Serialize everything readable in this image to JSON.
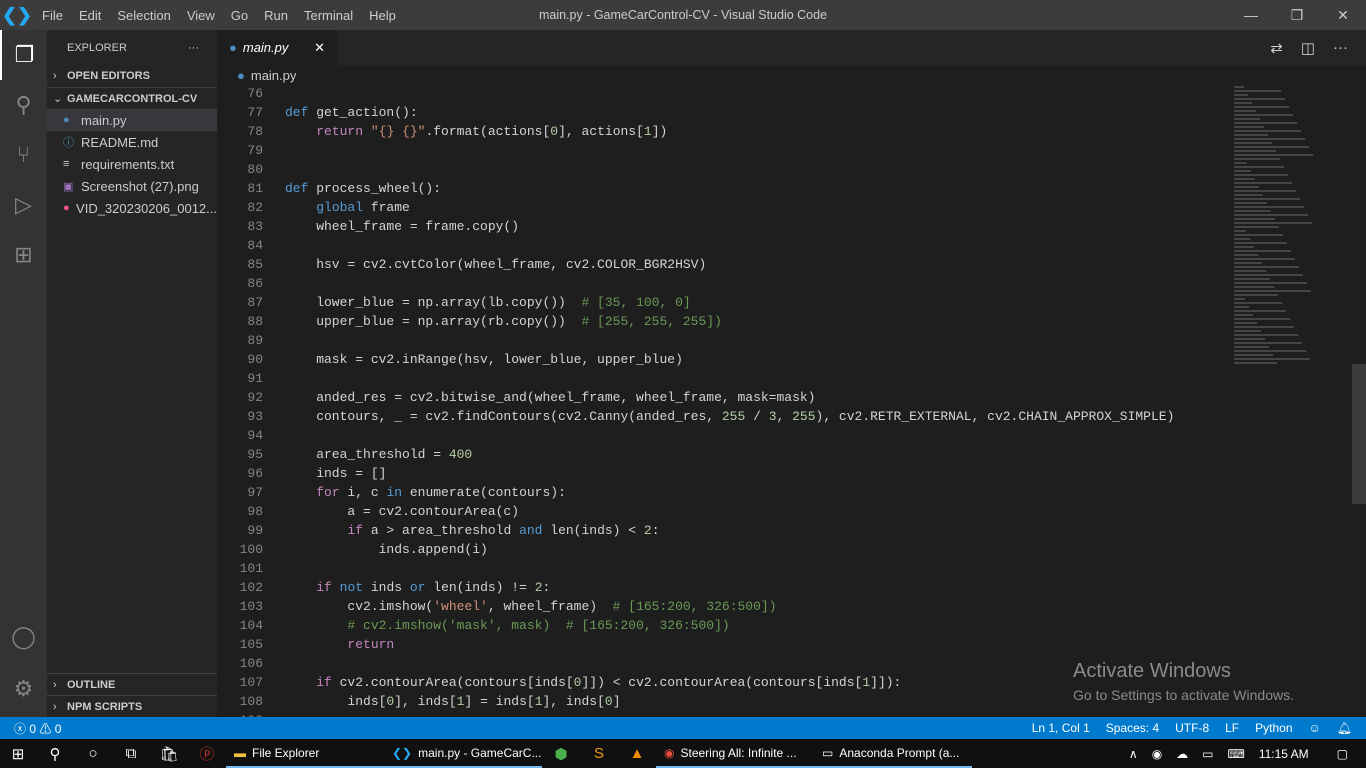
{
  "window": {
    "title": "main.py - GameCarControl-CV - Visual Studio Code",
    "menu": [
      "File",
      "Edit",
      "Selection",
      "View",
      "Go",
      "Run",
      "Terminal",
      "Help"
    ]
  },
  "sidebar": {
    "title": "EXPLORER",
    "open_editors": "OPEN EDITORS",
    "folder": "GAMECARCONTROL-CV",
    "files": [
      {
        "name": "main.py",
        "icon": "python-icon",
        "sel": true
      },
      {
        "name": "README.md",
        "icon": "info-icon"
      },
      {
        "name": "requirements.txt",
        "icon": "lines-icon"
      },
      {
        "name": "Screenshot (27).png",
        "icon": "image-icon"
      },
      {
        "name": "VID_320230206_0012...",
        "icon": "video-icon"
      }
    ],
    "outline": "OUTLINE",
    "npm": "NPM SCRIPTS"
  },
  "editor": {
    "tab": "main.py",
    "breadcrumb": "main.py",
    "lines": [
      [
        76,
        []
      ],
      [
        77,
        [
          [
            "k",
            "def"
          ],
          [
            "p",
            " get_action():"
          ]
        ]
      ],
      [
        78,
        [
          [
            "p",
            "    "
          ],
          [
            "c",
            "return"
          ],
          [
            "p",
            " "
          ],
          [
            "s",
            "\"{} {}\""
          ],
          [
            "p",
            ".format(actions["
          ],
          [
            "n",
            "0"
          ],
          [
            "p",
            "], actions["
          ],
          [
            "n",
            "1"
          ],
          [
            "p",
            "])"
          ]
        ]
      ],
      [
        79,
        []
      ],
      [
        80,
        []
      ],
      [
        81,
        [
          [
            "k",
            "def"
          ],
          [
            "p",
            " process_wheel():"
          ]
        ]
      ],
      [
        82,
        [
          [
            "p",
            "    "
          ],
          [
            "k",
            "global"
          ],
          [
            "p",
            " frame"
          ]
        ]
      ],
      [
        83,
        [
          [
            "p",
            "    wheel_frame = frame.copy()"
          ]
        ]
      ],
      [
        84,
        []
      ],
      [
        85,
        [
          [
            "p",
            "    hsv = cv2.cvtColor(wheel_frame, cv2.COLOR_BGR2HSV)"
          ]
        ]
      ],
      [
        86,
        []
      ],
      [
        87,
        [
          [
            "p",
            "    lower_blue = np.array(lb.copy())  "
          ],
          [
            "m",
            "# [35, 100, 0]"
          ]
        ]
      ],
      [
        88,
        [
          [
            "p",
            "    upper_blue = np.array(rb.copy())  "
          ],
          [
            "m",
            "# [255, 255, 255])"
          ]
        ]
      ],
      [
        89,
        []
      ],
      [
        90,
        [
          [
            "p",
            "    mask = cv2.inRange(hsv, lower_blue, upper_blue)"
          ]
        ]
      ],
      [
        91,
        []
      ],
      [
        92,
        [
          [
            "p",
            "    anded_res = cv2.bitwise_and(wheel_frame, wheel_frame, mask=mask)"
          ]
        ]
      ],
      [
        93,
        [
          [
            "p",
            "    contours, _ = cv2.findContours(cv2.Canny(anded_res, "
          ],
          [
            "n",
            "255"
          ],
          [
            "p",
            " / "
          ],
          [
            "n",
            "3"
          ],
          [
            "p",
            ", "
          ],
          [
            "n",
            "255"
          ],
          [
            "p",
            "), cv2.RETR_EXTERNAL, cv2.CHAIN_APPROX_SIMPLE)"
          ]
        ]
      ],
      [
        94,
        []
      ],
      [
        95,
        [
          [
            "p",
            "    area_threshold = "
          ],
          [
            "n",
            "400"
          ]
        ]
      ],
      [
        96,
        [
          [
            "p",
            "    inds = []"
          ]
        ]
      ],
      [
        97,
        [
          [
            "p",
            "    "
          ],
          [
            "c",
            "for"
          ],
          [
            "p",
            " i, c "
          ],
          [
            "k",
            "in"
          ],
          [
            "p",
            " enumerate(contours):"
          ]
        ]
      ],
      [
        98,
        [
          [
            "p",
            "        a = cv2.contourArea(c)"
          ]
        ]
      ],
      [
        99,
        [
          [
            "p",
            "        "
          ],
          [
            "c",
            "if"
          ],
          [
            "p",
            " a > area_threshold "
          ],
          [
            "k",
            "and"
          ],
          [
            "p",
            " len(inds) < "
          ],
          [
            "n",
            "2"
          ],
          [
            "p",
            ":"
          ]
        ]
      ],
      [
        100,
        [
          [
            "p",
            "            inds.append(i)"
          ]
        ]
      ],
      [
        101,
        []
      ],
      [
        102,
        [
          [
            "p",
            "    "
          ],
          [
            "c",
            "if"
          ],
          [
            "p",
            " "
          ],
          [
            "k",
            "not"
          ],
          [
            "p",
            " inds "
          ],
          [
            "k",
            "or"
          ],
          [
            "p",
            " len(inds) != "
          ],
          [
            "n",
            "2"
          ],
          [
            "p",
            ":"
          ]
        ]
      ],
      [
        103,
        [
          [
            "p",
            "        cv2.imshow("
          ],
          [
            "s",
            "'wheel'"
          ],
          [
            "p",
            ", wheel_frame)  "
          ],
          [
            "m",
            "# [165:200, 326:500])"
          ]
        ]
      ],
      [
        104,
        [
          [
            "p",
            "        "
          ],
          [
            "m",
            "# cv2.imshow('mask', mask)  # [165:200, 326:500])"
          ]
        ]
      ],
      [
        105,
        [
          [
            "p",
            "        "
          ],
          [
            "c",
            "return"
          ]
        ]
      ],
      [
        106,
        []
      ],
      [
        107,
        [
          [
            "p",
            "    "
          ],
          [
            "c",
            "if"
          ],
          [
            "p",
            " cv2.contourArea(contours[inds["
          ],
          [
            "n",
            "0"
          ],
          [
            "p",
            "]]) < cv2.contourArea(contours[inds["
          ],
          [
            "n",
            "1"
          ],
          [
            "p",
            "]]):"
          ]
        ]
      ],
      [
        108,
        [
          [
            "p",
            "        inds["
          ],
          [
            "n",
            "0"
          ],
          [
            "p",
            "], inds["
          ],
          [
            "n",
            "1"
          ],
          [
            "p",
            "] = inds["
          ],
          [
            "n",
            "1"
          ],
          [
            "p",
            "], inds["
          ],
          [
            "n",
            "0"
          ],
          [
            "p",
            "]"
          ]
        ]
      ],
      [
        109,
        []
      ]
    ]
  },
  "watermark": {
    "title": "Activate Windows",
    "sub": "Go to Settings to activate Windows."
  },
  "status": {
    "errors": "0",
    "warnings": "0",
    "position": "Ln 1, Col 1",
    "spaces": "Spaces: 4",
    "encoding": "UTF-8",
    "eol": "LF",
    "language": "Python"
  },
  "taskbar": {
    "apps": [
      "File Explorer",
      "main.py - GameCarC...",
      "Steering All: Infinite ...",
      "Anaconda Prompt (a..."
    ],
    "time": "11:15 AM"
  },
  "colors": {
    "accent": "#007acc",
    "keyword": "#569cd6",
    "control": "#c586c0",
    "string": "#ce9178",
    "comment": "#6a9955",
    "number": "#b5cea8"
  }
}
